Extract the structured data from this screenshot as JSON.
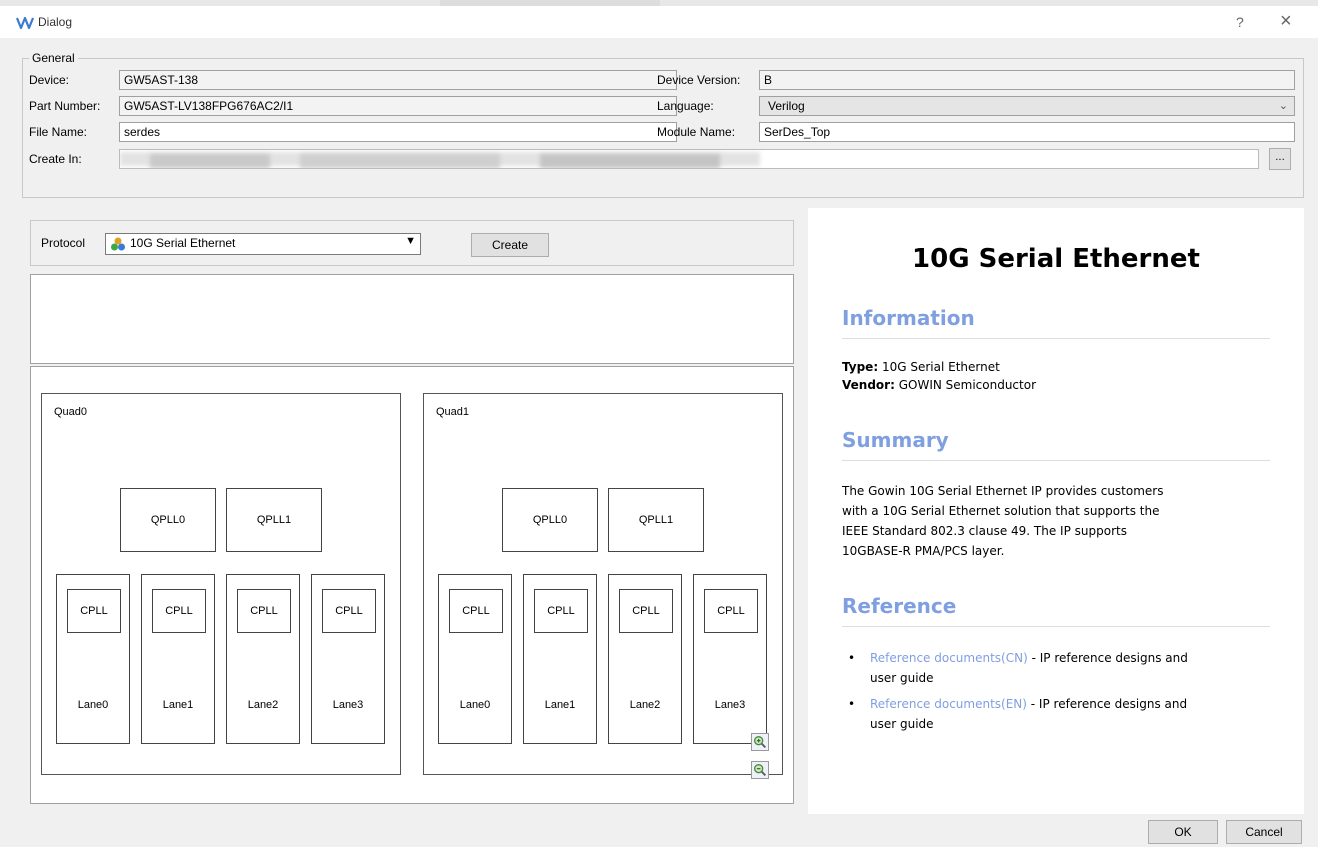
{
  "window": {
    "title": "Dialog",
    "help_label": "?",
    "close_label": "×"
  },
  "general": {
    "legend": "General",
    "device_label": "Device:",
    "device_value": "GW5AST-138",
    "part_number_label": "Part Number:",
    "part_number_value": "GW5AST-LV138FPG676AC2/I1",
    "file_name_label": "File Name:",
    "file_name_value": "serdes",
    "create_in_label": "Create In:",
    "browse_label": "...",
    "device_version_label": "Device Version:",
    "device_version_value": "B",
    "language_label": "Language:",
    "language_value": "Verilog",
    "module_name_label": "Module Name:",
    "module_name_value": "SerDes_Top"
  },
  "protocol": {
    "label": "Protocol",
    "selected": "10G Serial Ethernet",
    "create_label": "Create"
  },
  "diagram": {
    "quads": [
      {
        "label": "Quad0",
        "qplls": [
          "QPLL0",
          "QPLL1"
        ],
        "lanes": [
          {
            "cpll": "CPLL",
            "label": "Lane0"
          },
          {
            "cpll": "CPLL",
            "label": "Lane1"
          },
          {
            "cpll": "CPLL",
            "label": "Lane2"
          },
          {
            "cpll": "CPLL",
            "label": "Lane3"
          }
        ]
      },
      {
        "label": "Quad1",
        "qplls": [
          "QPLL0",
          "QPLL1"
        ],
        "lanes": [
          {
            "cpll": "CPLL",
            "label": "Lane0"
          },
          {
            "cpll": "CPLL",
            "label": "Lane1"
          },
          {
            "cpll": "CPLL",
            "label": "Lane2"
          },
          {
            "cpll": "CPLL",
            "label": "Lane3"
          }
        ]
      }
    ],
    "zoom_in_icon": "zoom-in-icon",
    "zoom_out_icon": "zoom-out-icon"
  },
  "info": {
    "title": "10G Serial Ethernet",
    "information_heading": "Information",
    "type_label": "Type:",
    "type_value": "10G Serial Ethernet",
    "vendor_label": "Vendor:",
    "vendor_value": "GOWIN Semiconductor",
    "summary_heading": "Summary",
    "summary_lines": [
      "The Gowin 10G Serial Ethernet IP provides customers",
      "with a 10G Serial Ethernet solution that supports the",
      "IEEE Standard 802.3 clause 49. The IP supports",
      "10GBASE-R PMA/PCS layer."
    ],
    "reference_heading": "Reference",
    "references": [
      {
        "link": "Reference documents(CN)",
        "text_line1": " - IP reference designs and",
        "text_line2": "user guide"
      },
      {
        "link": "Reference documents(EN)",
        "text_line1": " - IP reference designs and",
        "text_line2": "user guide"
      }
    ]
  },
  "footer": {
    "ok_label": "OK",
    "cancel_label": "Cancel"
  },
  "colors": {
    "heading_accent": "#7f9fe0",
    "window_bg": "#f0f0f0"
  }
}
